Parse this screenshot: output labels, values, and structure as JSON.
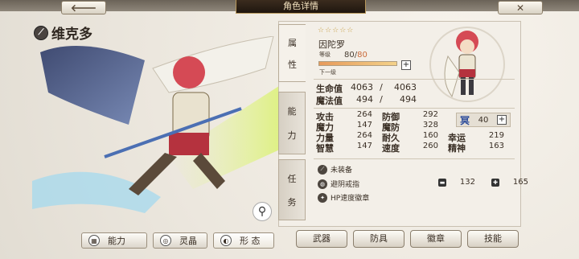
{
  "header": {
    "title": "角色详情",
    "back_icon": "back-arrow-icon",
    "close_icon": "close-x-icon"
  },
  "character": {
    "name": "维克多"
  },
  "panel": {
    "side_tabs": [
      {
        "chars": [
          "属",
          "性"
        ]
      },
      {
        "chars": [
          "能",
          "力"
        ]
      },
      {
        "chars": [
          "任",
          "务"
        ]
      }
    ],
    "stars": "☆☆☆☆☆",
    "sub_name": "因陀罗",
    "level_label": "等级",
    "level_current": "80",
    "level_sep": "/",
    "level_max": "80",
    "level_progress": 1.0,
    "next_level_label": "下一级",
    "hp": {
      "label": "生命值",
      "current": "4063",
      "sep": "/",
      "max": "4063"
    },
    "mp": {
      "label": "魔法值",
      "current": "494",
      "sep": "/",
      "max": "494"
    },
    "stats": [
      [
        {
          "k": "攻击",
          "v": "264"
        },
        {
          "k": "防御",
          "v": "292"
        }
      ],
      [
        {
          "k": "魔力",
          "v": "147"
        },
        {
          "k": "魔防",
          "v": "328"
        }
      ],
      [
        {
          "k": "力量",
          "v": "264"
        },
        {
          "k": "耐久",
          "v": "160"
        },
        {
          "k": "幸运",
          "v": "219"
        }
      ],
      [
        {
          "k": "智慧",
          "v": "147"
        },
        {
          "k": "速度",
          "v": "260"
        },
        {
          "k": "精神",
          "v": "163"
        }
      ]
    ],
    "special": {
      "icon": "冥",
      "value": "40"
    },
    "equipment": [
      {
        "icon": "slash-icon",
        "label": "未装备"
      },
      {
        "icon": "ring-icon",
        "label": "避阴戒指"
      },
      {
        "icon": "badge-icon",
        "label": "HP速度徽章"
      }
    ],
    "ring_stats": {
      "def": "132",
      "mdef": "165"
    }
  },
  "bottom_tabs": [
    {
      "icon": "grid-icon",
      "label": "能力"
    },
    {
      "icon": "orb-icon",
      "label": "灵晶"
    },
    {
      "icon": "form-icon",
      "label": "形 态"
    }
  ],
  "action_buttons": [
    "武器",
    "防具",
    "徽章",
    "技能"
  ],
  "colors": {
    "accent": "#c8a24a",
    "level_max": "#c96a3a",
    "title_bg": "#2b1f15"
  }
}
